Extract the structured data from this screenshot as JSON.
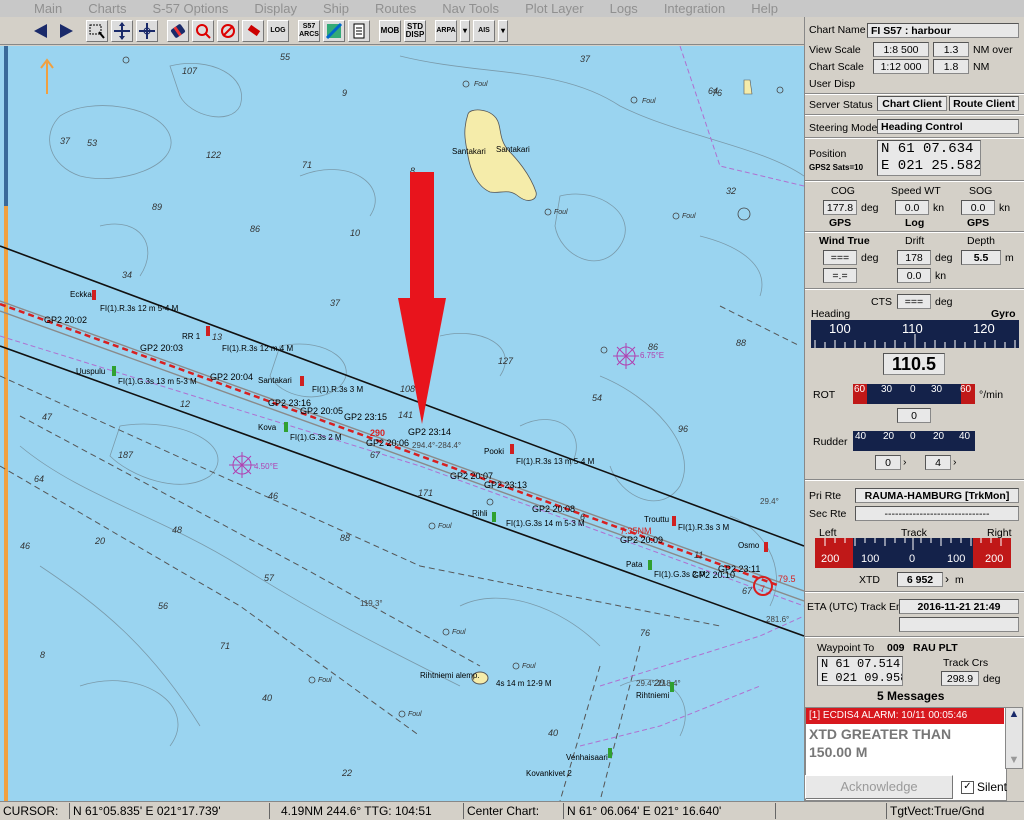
{
  "menu": [
    "Main",
    "Charts",
    "S-57 Options",
    "Display",
    "Ship",
    "Routes",
    "Nav Tools",
    "Plot Layer",
    "Logs",
    "Integration",
    "Help"
  ],
  "toolbar": {
    "s57arcs": "S57 ARCS",
    "log": "LOG",
    "mob": "MOB",
    "std_disp": "STD DISP",
    "arpa": "ARPA",
    "ais": "AIS"
  },
  "chart": {
    "island_labels": [
      "Santakari",
      "Santakari"
    ],
    "route_labels": [
      "GP2 20:02",
      "GP2 20:03",
      "GP2 20:04",
      "GP2 23:16",
      "GP2 20:05",
      "GP2 23:15",
      "GP2 23:14",
      "GP2 20:06",
      "GP2 20:07",
      "GP2 23:13",
      "GP2 20:08",
      "GP2 20:09",
      "GP2 23:11",
      "GP2 20:10"
    ],
    "light_labels": [
      "Eckka",
      "FI(1).R.3s 12 m 5-4 M",
      "RR 1",
      "FI(1).R.3s 12 m 4 M",
      "Uuspulu",
      "FI(1).G.3s 13 m 5-3 M",
      "Santakari",
      "FI(1).R.3s 3 M",
      "Kova",
      "FI(1).G.3s 2 M",
      "Pooki",
      "FI(1).R.3s 13 m 5-4 M",
      "Rihli",
      "FI(1).G.3s 14 m 5-3 M",
      "Trouttu",
      "FI(1).R.3s 3 M",
      "Pata",
      "FI(1).G.3s 2 M",
      "Osmo",
      "Rihtniemi alemp.",
      "Rihtniemi",
      "Venhaisaari",
      "Kovankivet 2",
      "4s 14 m 12-9 M"
    ],
    "foul": "Foul",
    "bearing_labels": [
      "290",
      "294.4°-284.4°",
      "7.35NM",
      "79.5",
      "281.6°",
      "29.4°",
      "29.4°",
      "119.3°",
      "29.4°-218.4°"
    ],
    "depths": [
      "55",
      "107",
      "9",
      "13",
      "37",
      "53",
      "122",
      "71",
      "89",
      "8",
      "86",
      "10",
      "76",
      "34",
      "37",
      "32",
      "37",
      "108",
      "127",
      "88",
      "86",
      "54",
      "96",
      "64",
      "7",
      "36",
      "141",
      "47",
      "12",
      "67",
      "46",
      "171",
      "187",
      "20",
      "64",
      "46",
      "48",
      "88",
      "6",
      "11",
      "67",
      "152",
      "57",
      "56",
      "71",
      "40",
      "8",
      "43",
      "22",
      "40",
      "10",
      "9",
      "2",
      "5",
      "17",
      "24",
      "20",
      "76",
      "77",
      "70",
      "47",
      "9",
      "8"
    ],
    "variation": [
      "4.50°E",
      "6.75°E"
    ],
    "waypoint": "7"
  },
  "panel": {
    "chart_name_label": "Chart Name",
    "chart_name": "FI S57 : harbour",
    "view_scale_label": "View Scale",
    "view_scale": "1:8 500",
    "view_nm": "1.3",
    "nm_over": "NM over",
    "chart_scale_label": "Chart Scale",
    "chart_scale": "1:12 000",
    "chart_nm": "1.8",
    "nm": "NM",
    "user_disp": "User Disp",
    "server_status_label": "Server Status",
    "chart_client": "Chart Client",
    "route_client": "Route Client",
    "steering_mode_label": "Steering Mode",
    "steering_mode": "Heading Control",
    "position_label": "Position",
    "gps_sats": "GPS2 Sats=10",
    "lat": "N   61   07.634",
    "lon": "E  021   25.582",
    "cog_label": "COG",
    "cog": "177.8",
    "deg": "deg",
    "gps": "GPS",
    "speed_wt_label": "Speed WT",
    "speed_wt": "0.0",
    "kn": "kn",
    "log": "Log",
    "sog_label": "SOG",
    "sog": "0.0",
    "gps2": "GPS",
    "wind_label": "Wind True",
    "wind": "===",
    "wind2": "=.=",
    "drift_label": "Drift",
    "drift": "178",
    "drift_kn": "0.0",
    "depth_label": "Depth",
    "depth": "5.5",
    "m": "m",
    "cts_label": "CTS",
    "cts": "===",
    "heading_label": "Heading",
    "gyro": "Gyro",
    "heading_ticks": [
      "100",
      "110",
      "120"
    ],
    "heading": "110.5",
    "rot_label": "ROT",
    "rot_ticks": [
      "60",
      "30",
      "0",
      "30",
      "60"
    ],
    "rot_unit": "°/min",
    "rot": "0",
    "rudder_label": "Rudder",
    "rudder_ticks": [
      "40",
      "20",
      "0",
      "20",
      "40"
    ],
    "rudder_a": "0",
    "rudder_b": "4",
    "pri_rte_label": "Pri Rte",
    "pri_rte": "RAUMA-HAMBURG [TrkMon]",
    "sec_rte_label": "Sec Rte",
    "sec_rte": "------------------------------",
    "left": "Left",
    "track": "Track",
    "right": "Right",
    "track_ticks": [
      "200",
      "100",
      "0",
      "100",
      "200"
    ],
    "xtd_label": "XTD",
    "xtd": "6 952",
    "eta_label": "ETA (UTC) Track End",
    "eta": "2016-11-21   21:49",
    "waypoint_to_label": "Waypoint To",
    "waypoint_no": "009",
    "waypoint_name": "RAU PLT",
    "wp_lat": "N   61   07.514",
    "wp_lon": "E  021   09.958",
    "track_crs_label": "Track Crs",
    "track_crs": "298.9",
    "messages_title": "5 Messages",
    "alarm_header": "[1] ECDIS4 ALARM: 10/11 00:05:46",
    "alarm_text1": "XTD GREATER THAN",
    "alarm_text2": "150.00 M",
    "acknowledge": "Acknowledge",
    "silent": "Silent"
  },
  "status": {
    "cursor_label": "CURSOR:",
    "cursor_pos": "N 61°05.835'  E 021°17.739'",
    "range": "4.19NM 244.6° TTG: 104:51",
    "center_label": "Center Chart:",
    "center_pos": "N 61° 06.064'  E 021° 16.640'",
    "tgt_vect": "TgtVect:True/Gnd"
  },
  "colors": {
    "sea": "#9ad4f0",
    "land": "#f5ecaa",
    "alarm_red": "#d8181e",
    "arrow_red": "#e8141c",
    "scale_blue": "#14224a"
  }
}
